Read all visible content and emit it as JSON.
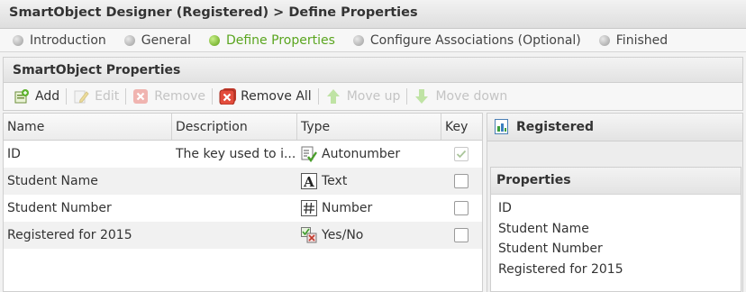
{
  "header": {
    "title": "SmartObject Designer (Registered) > Define Properties"
  },
  "steps": [
    {
      "label": "Introduction",
      "active": false
    },
    {
      "label": "General",
      "active": false
    },
    {
      "label": "Define Properties",
      "active": true
    },
    {
      "label": "Configure Associations (Optional)",
      "active": false
    },
    {
      "label": "Finished",
      "active": false
    }
  ],
  "panel": {
    "title": "SmartObject Properties"
  },
  "toolbar": {
    "add": "Add",
    "edit": "Edit",
    "remove": "Remove",
    "remove_all": "Remove All",
    "move_up": "Move up",
    "move_down": "Move down"
  },
  "grid": {
    "columns": {
      "name": "Name",
      "description": "Description",
      "type": "Type",
      "key": "Key"
    },
    "rows": [
      {
        "name": "ID",
        "description": "The key used to i...",
        "type": "Autonumber",
        "type_icon": "autonumber-icon",
        "key": true
      },
      {
        "name": "Student Name",
        "description": "",
        "type": "Text",
        "type_icon": "text-type-icon",
        "key": false
      },
      {
        "name": "Student Number",
        "description": "",
        "type": "Number",
        "type_icon": "number-type-icon",
        "key": false
      },
      {
        "name": "Registered for 2015",
        "description": "",
        "type": "Yes/No",
        "type_icon": "yes-no-type-icon",
        "key": false
      }
    ]
  },
  "side": {
    "title": "Registered",
    "properties_title": "Properties",
    "properties": [
      "ID",
      "Student Name",
      "Student Number",
      "Registered for 2015"
    ]
  },
  "colors": {
    "active_step": "#5aa51f",
    "disabled": "#c4c4c4"
  }
}
